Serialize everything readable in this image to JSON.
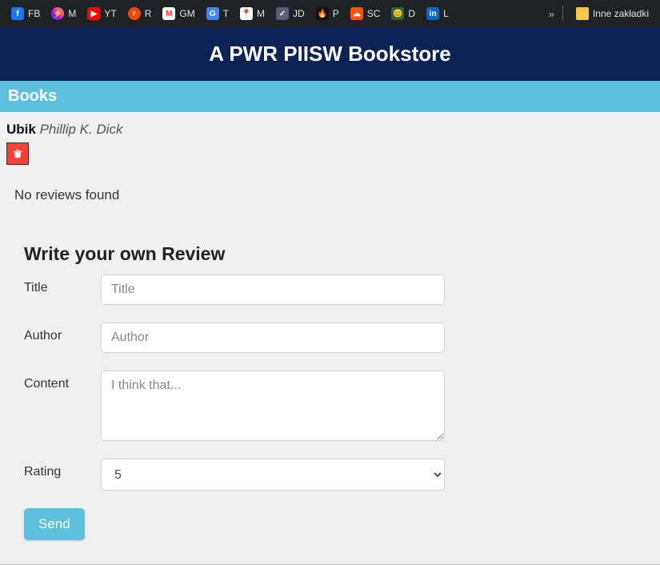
{
  "bookmarks": {
    "items": [
      {
        "label": "FB",
        "icon": "fb"
      },
      {
        "label": "M",
        "icon": "m"
      },
      {
        "label": "YT",
        "icon": "yt"
      },
      {
        "label": "R",
        "icon": "r"
      },
      {
        "label": "GM",
        "icon": "gm"
      },
      {
        "label": "T",
        "icon": "t"
      },
      {
        "label": "M",
        "icon": "mp"
      },
      {
        "label": "JD",
        "icon": "jd"
      },
      {
        "label": "P",
        "icon": "p"
      },
      {
        "label": "SC",
        "icon": "sc"
      },
      {
        "label": "D",
        "icon": "d"
      },
      {
        "label": "L",
        "icon": "l"
      }
    ],
    "overflow": "»",
    "folder_label": "Inne zakładki"
  },
  "header": {
    "title": "A PWR PIISW Bookstore"
  },
  "subnav": {
    "label": "Books"
  },
  "book": {
    "title": "Ubik",
    "author": "Phillip K. Dick"
  },
  "reviews": {
    "no_reviews_text": "No reviews found"
  },
  "form": {
    "heading": "Write your own Review",
    "title_label": "Title",
    "title_placeholder": "Title",
    "author_label": "Author",
    "author_placeholder": "Author",
    "content_label": "Content",
    "content_placeholder": "I think that...",
    "rating_label": "Rating",
    "rating_selected": "5",
    "send_label": "Send"
  }
}
